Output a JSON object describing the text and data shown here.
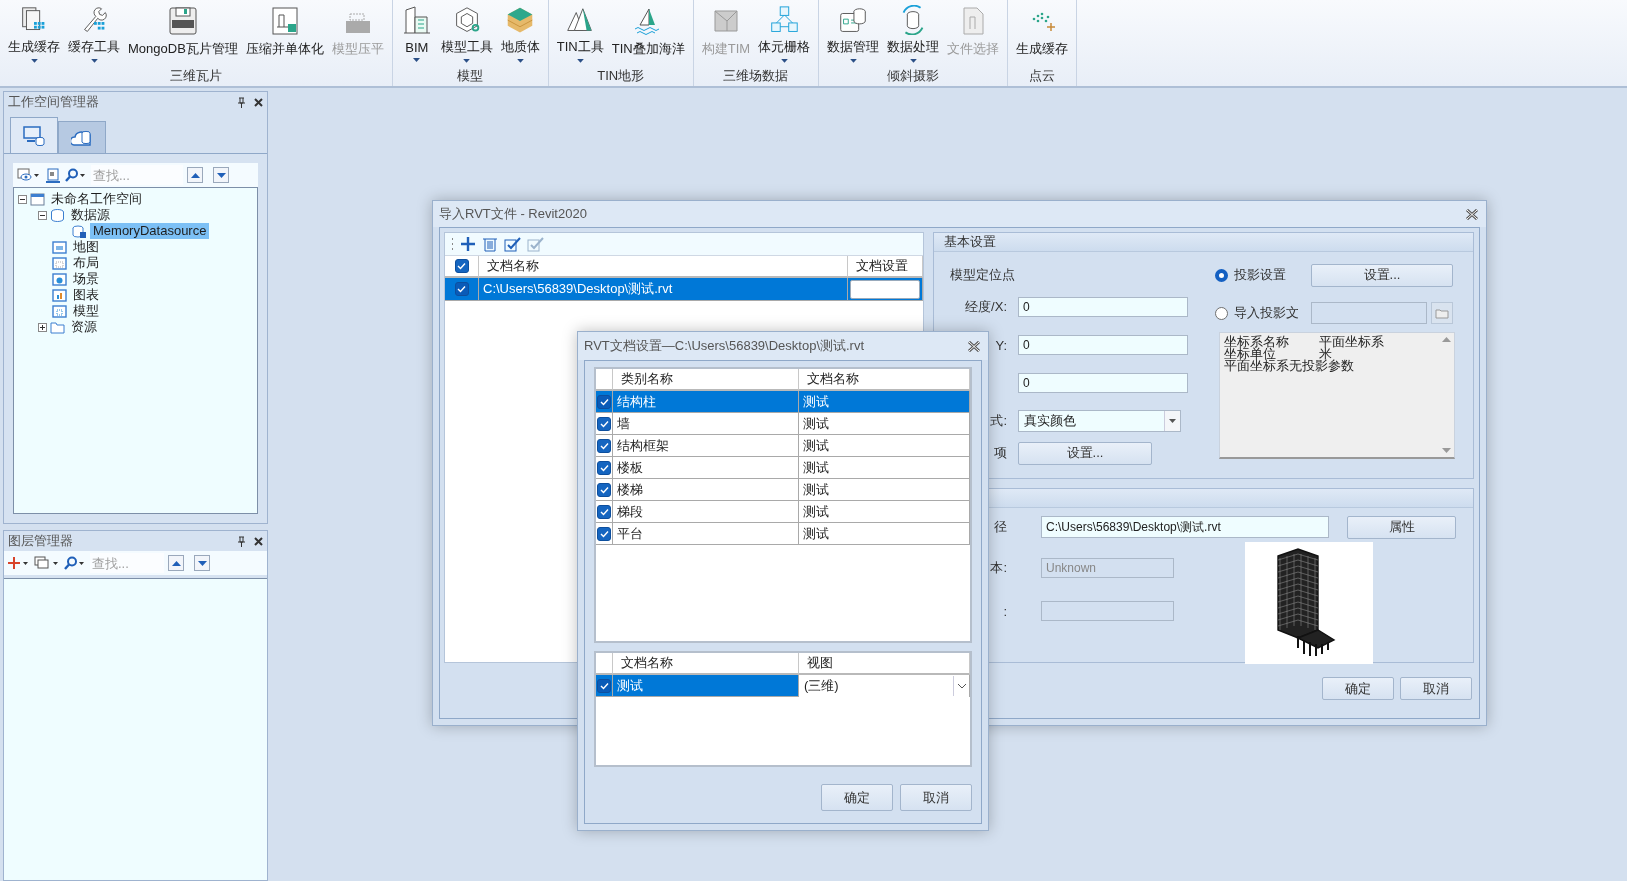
{
  "ribbon": {
    "groups": [
      {
        "label": "三维瓦片",
        "items": [
          {
            "label": "生成缓存",
            "kind": "tile_stack",
            "dropdown": true,
            "disabled": false
          },
          {
            "label": "缓存工具",
            "kind": "wrench",
            "dropdown": true,
            "disabled": false
          },
          {
            "label": "MongoDB瓦片管理",
            "kind": "floppy",
            "dropdown": false,
            "disabled": false
          },
          {
            "label": "压缩并单体化",
            "kind": "doc_building",
            "dropdown": false,
            "disabled": false
          },
          {
            "label": "模型压平",
            "kind": "flat_block",
            "dropdown": false,
            "disabled": true
          }
        ]
      },
      {
        "label": "模型",
        "items": [
          {
            "label": "BIM",
            "kind": "building",
            "dropdown": true,
            "disabled": false
          },
          {
            "label": "模型工具",
            "kind": "hex_wrench",
            "dropdown": true,
            "disabled": false
          },
          {
            "label": "地质体",
            "kind": "soil",
            "dropdown": true,
            "disabled": false
          }
        ]
      },
      {
        "label": "TIN地形",
        "items": [
          {
            "label": "TIN工具",
            "kind": "mountains",
            "dropdown": true,
            "disabled": false
          },
          {
            "label": "TIN叠加海洋",
            "kind": "sail",
            "dropdown": false,
            "disabled": false
          }
        ]
      },
      {
        "label": "三维场数据",
        "items": [
          {
            "label": "构建TIM",
            "kind": "cube",
            "dropdown": false,
            "disabled": true
          },
          {
            "label": "体元栅格",
            "kind": "cubes",
            "dropdown": true,
            "disabled": false
          }
        ]
      },
      {
        "label": "倾斜摄影",
        "items": [
          {
            "label": "数据管理",
            "kind": "db_card",
            "dropdown": true,
            "disabled": false
          },
          {
            "label": "数据处理",
            "kind": "db_cycle",
            "dropdown": true,
            "disabled": false
          },
          {
            "label": "文件选择",
            "kind": "document",
            "dropdown": false,
            "disabled": true
          }
        ]
      },
      {
        "label": "点云",
        "items": [
          {
            "label": "生成缓存",
            "kind": "points",
            "dropdown": false,
            "disabled": false
          }
        ]
      }
    ]
  },
  "workspace_manager": {
    "title": "工作空间管理器",
    "tabs": [
      {
        "kind": "computer",
        "selected": true
      },
      {
        "kind": "cloud",
        "selected": false
      }
    ],
    "search": {
      "placeholder": "查找..."
    },
    "tree": [
      {
        "label": "未命名工作空间",
        "kind": "workspace",
        "expanded": true,
        "selected": false,
        "children": [
          {
            "label": "数据源",
            "kind": "datasource",
            "expanded": true,
            "selected": false,
            "children": [
              {
                "label": "MemoryDatasource",
                "kind": "memory",
                "selected": true
              }
            ]
          },
          {
            "label": "地图",
            "kind": "map",
            "selected": false
          },
          {
            "label": "布局",
            "kind": "layout",
            "selected": false
          },
          {
            "label": "场景",
            "kind": "scene",
            "selected": false
          },
          {
            "label": "图表",
            "kind": "chart",
            "selected": false
          },
          {
            "label": "模型",
            "kind": "model",
            "selected": false
          },
          {
            "label": "资源",
            "kind": "folder",
            "expanded": false,
            "selected": false
          }
        ]
      }
    ]
  },
  "layer_manager": {
    "title": "图层管理器",
    "search": {
      "placeholder": "查找..."
    }
  },
  "import_dialog": {
    "title": "导入RVT文件 - Revit2020",
    "files": {
      "all_checked": true,
      "columns": [
        "文档名称",
        "文档设置"
      ],
      "rows": [
        {
          "checked": true,
          "selected": true,
          "path": "C:\\Users\\56839\\Desktop\\测试.rvt"
        }
      ]
    },
    "basic": {
      "title": "基本设置",
      "anchor_label": "模型定位点",
      "coords": [
        {
          "label": "经度/X:",
          "value": "0"
        },
        {
          "label": "Y:",
          "value": "0"
        },
        {
          "value": "0"
        }
      ],
      "color_mode": {
        "label": "式:",
        "value": "真实颜色"
      },
      "options": {
        "label": "项",
        "button": "设置..."
      },
      "projection": [
        {
          "label": "投影设置",
          "selected": true
        },
        {
          "label": "导入投影文",
          "selected": false
        }
      ],
      "projection_button": "设置...",
      "info_lines": [
        [
          "坐标系名称",
          "平面坐标系"
        ],
        [
          "坐标单位",
          "米"
        ],
        [
          "平面坐标系无投影参数"
        ]
      ]
    },
    "model": {
      "path": {
        "label": "径",
        "value": "C:\\Users\\56839\\Desktop\\测试.rvt"
      },
      "properties_button": "属性",
      "version": {
        "label": "本:",
        "value": "Unknown"
      },
      "extra": {
        "label": ":"
      }
    },
    "buttons": [
      "确定",
      "取消"
    ]
  },
  "settings_dialog": {
    "title": "RVT文档设置—C:\\Users\\56839\\Desktop\\测试.rvt",
    "categories": {
      "columns": [
        "类别名称",
        "文档名称"
      ],
      "rows": [
        {
          "checked": true,
          "selected": true,
          "category": "结构柱",
          "document": "测试"
        },
        {
          "checked": true,
          "selected": false,
          "category": "墙",
          "document": "测试"
        },
        {
          "checked": true,
          "selected": false,
          "category": "结构框架",
          "document": "测试"
        },
        {
          "checked": true,
          "selected": false,
          "category": "楼板",
          "document": "测试"
        },
        {
          "checked": true,
          "selected": false,
          "category": "楼梯",
          "document": "测试"
        },
        {
          "checked": true,
          "selected": false,
          "category": "梯段",
          "document": "测试"
        },
        {
          "checked": true,
          "selected": false,
          "category": "平台",
          "document": "测试"
        }
      ]
    },
    "views": {
      "columns": [
        "文档名称",
        "视图"
      ],
      "rows": [
        {
          "checked": true,
          "selected": true,
          "document": "测试",
          "view": "(三维)"
        }
      ]
    },
    "buttons": [
      "确定",
      "取消"
    ]
  }
}
